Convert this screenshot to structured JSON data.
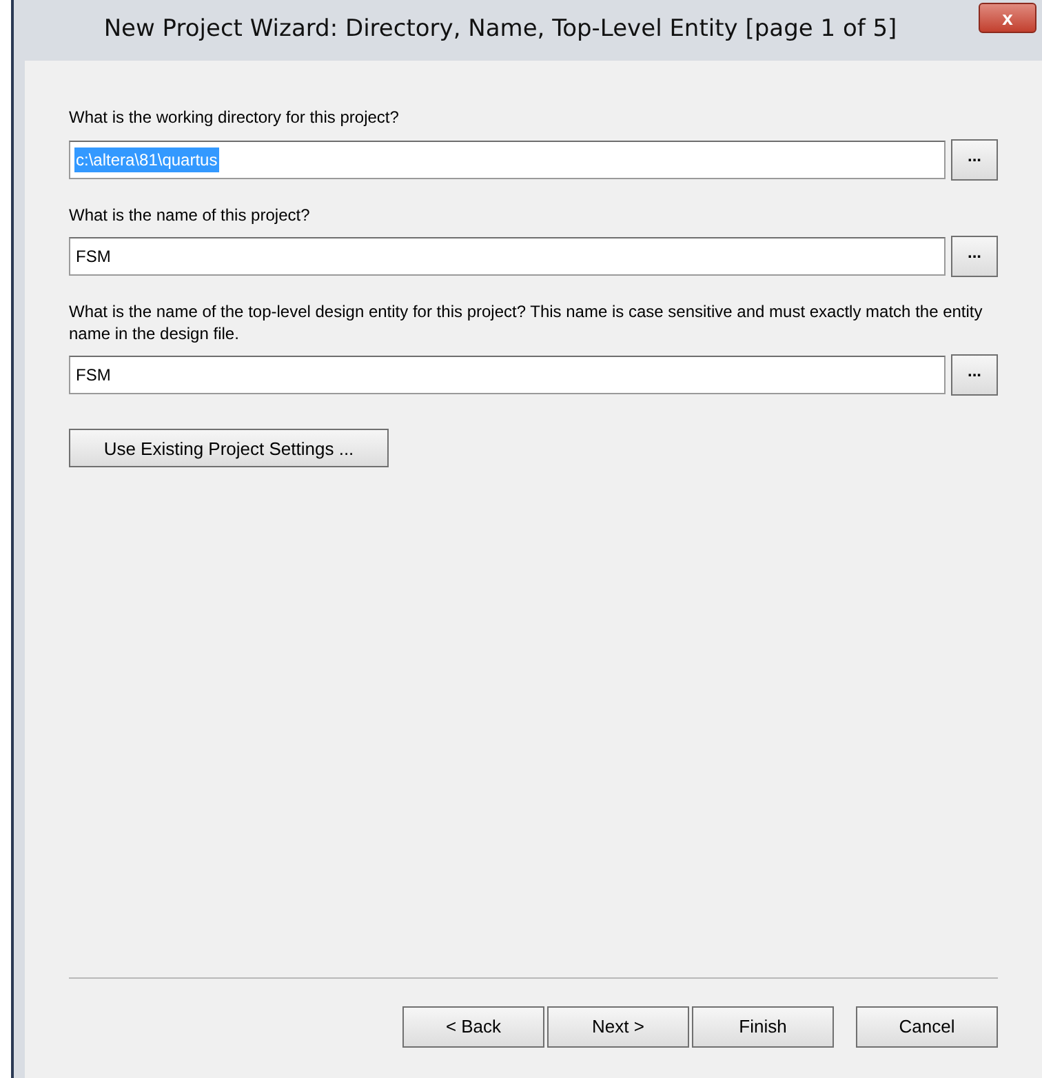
{
  "window": {
    "title": "New Project Wizard: Directory, Name, Top-Level Entity [page 1 of 5]",
    "close": "x"
  },
  "fields": [
    {
      "label": "What is the working directory for this project?",
      "value": "c:\\altera\\81\\quartus",
      "text_selected": true,
      "browse": "..."
    },
    {
      "label": "What is the name of this project?",
      "value": "FSM",
      "text_selected": false,
      "browse": "..."
    },
    {
      "label": "What is the name of the top-level design entity for this project? This name is case sensitive and must exactly match the entity name in the design file.",
      "value": "FSM",
      "text_selected": false,
      "browse": "..."
    }
  ],
  "settings_button": "Use Existing Project Settings ...",
  "buttons": [
    "< Back",
    "Next >",
    "Finish",
    "Cancel"
  ]
}
